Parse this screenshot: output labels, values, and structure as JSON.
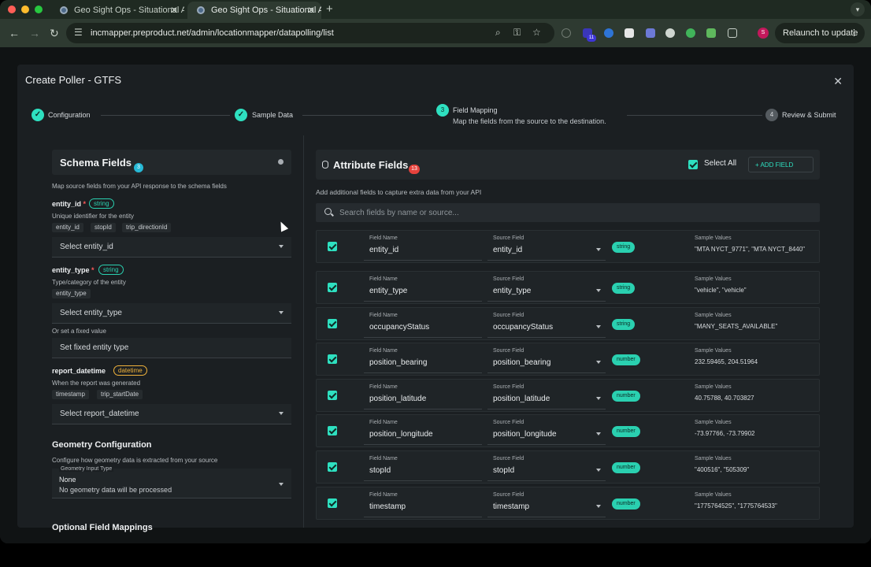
{
  "browser": {
    "tabs": [
      {
        "title": "Geo Sight Ops - Situational A"
      },
      {
        "title": "Geo Sight Ops - Situational A"
      }
    ],
    "url": "incmapper.preproduct.net/admin/locationmapper/datapolling/list",
    "relaunch_label": "Relaunch to update",
    "ext_badge": "11",
    "profile_initial": "S"
  },
  "modal": {
    "title": "Create Poller - GTFS",
    "steps": [
      {
        "label": "Configuration",
        "state": "done",
        "number": ""
      },
      {
        "label": "Sample Data",
        "state": "done",
        "number": ""
      },
      {
        "label": "Field Mapping",
        "state": "active",
        "number": "3",
        "sub": "Map the fields from the source to the destination."
      },
      {
        "label": "Review & Submit",
        "state": "todo",
        "number": "4"
      }
    ]
  },
  "schema": {
    "title": "Schema Fields",
    "count": "3",
    "desc": "Map source fields from your API response to the schema fields",
    "fields": [
      {
        "name": "entity_id",
        "required": "*",
        "type": "string",
        "desc": "Unique identifier for the entity",
        "chips": [
          "entity_id",
          "stopId",
          "trip_directionId"
        ],
        "select": "Select entity_id"
      },
      {
        "name": "entity_type",
        "required": "*",
        "type": "string",
        "desc": "Type/category of the entity",
        "chips": [
          "entity_type"
        ],
        "select": "Select entity_type",
        "fixed_label": "Or set a fixed value",
        "fixed_placeholder": "Set fixed entity type"
      },
      {
        "name": "report_datetime",
        "required": "",
        "type": "datetime",
        "desc": "When the report was generated",
        "chips": [
          "timestamp",
          "trip_startDate"
        ],
        "select": "Select report_datetime"
      }
    ],
    "geometry": {
      "title": "Geometry Configuration",
      "desc": "Configure how geometry data is extracted from your source",
      "input_label": "Geometry Input Type",
      "value": "None",
      "helper": "No geometry data will be processed"
    },
    "optional_title": "Optional Field Mappings"
  },
  "attributes": {
    "title": "Attribute Fields",
    "count": "13",
    "select_all": "Select All",
    "add_field": "+ ADD FIELD",
    "desc": "Add additional fields to capture extra data from your API",
    "search_placeholder": "Search fields by name or source...",
    "field_name_caption": "Field Name",
    "source_caption": "Source Field",
    "sample_caption": "Sample Values",
    "rows": [
      {
        "field": "entity_id",
        "source": "entity_id",
        "type": "string",
        "sample": "\"MTA NYCT_9771\", \"MTA NYCT_8440\""
      },
      {
        "field": "entity_type",
        "source": "entity_type",
        "type": "string",
        "sample": "\"vehicle\", \"vehicle\""
      },
      {
        "field": "occupancyStatus",
        "source": "occupancyStatus",
        "type": "string",
        "sample": "\"MANY_SEATS_AVAILABLE\""
      },
      {
        "field": "position_bearing",
        "source": "position_bearing",
        "type": "number",
        "sample": "232.59465, 204.51964"
      },
      {
        "field": "position_latitude",
        "source": "position_latitude",
        "type": "number",
        "sample": "40.75788, 40.703827"
      },
      {
        "field": "position_longitude",
        "source": "position_longitude",
        "type": "number",
        "sample": "-73.97766, -73.79902"
      },
      {
        "field": "stopId",
        "source": "stopId",
        "type": "number",
        "sample": "\"400516\", \"505309\""
      },
      {
        "field": "timestamp",
        "source": "timestamp",
        "type": "number",
        "sample": "\"1775764525\", \"1775764533\""
      }
    ]
  }
}
